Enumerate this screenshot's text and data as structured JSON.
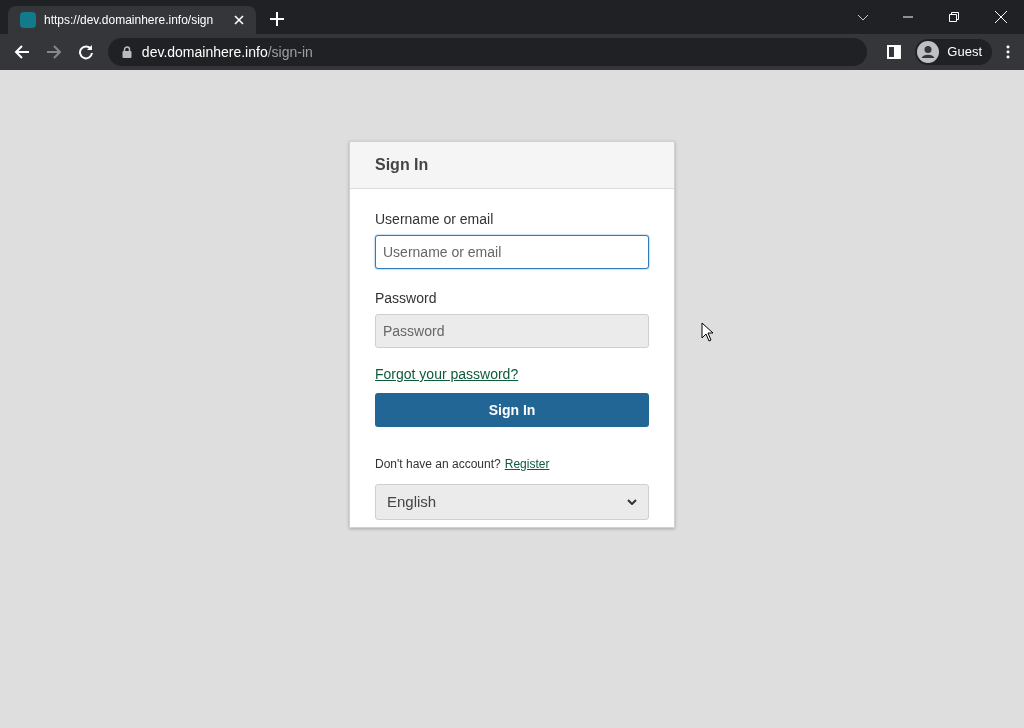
{
  "browser": {
    "tab": {
      "title": "https://dev.domainhere.info/sign"
    },
    "address": {
      "host": "dev.domainhere.info",
      "path": "/sign-in"
    },
    "profile": "Guest"
  },
  "card": {
    "title": "Sign In",
    "fields": [
      {
        "label": "Username or email",
        "placeholder": "Username or email",
        "focused": true
      },
      {
        "label": "Password",
        "placeholder": "Password",
        "focused": false
      }
    ],
    "forgot_link": "Forgot your password?",
    "submit": "Sign In",
    "register_prompt": "Don't have an account?",
    "register_link": "Register",
    "language": "English"
  }
}
